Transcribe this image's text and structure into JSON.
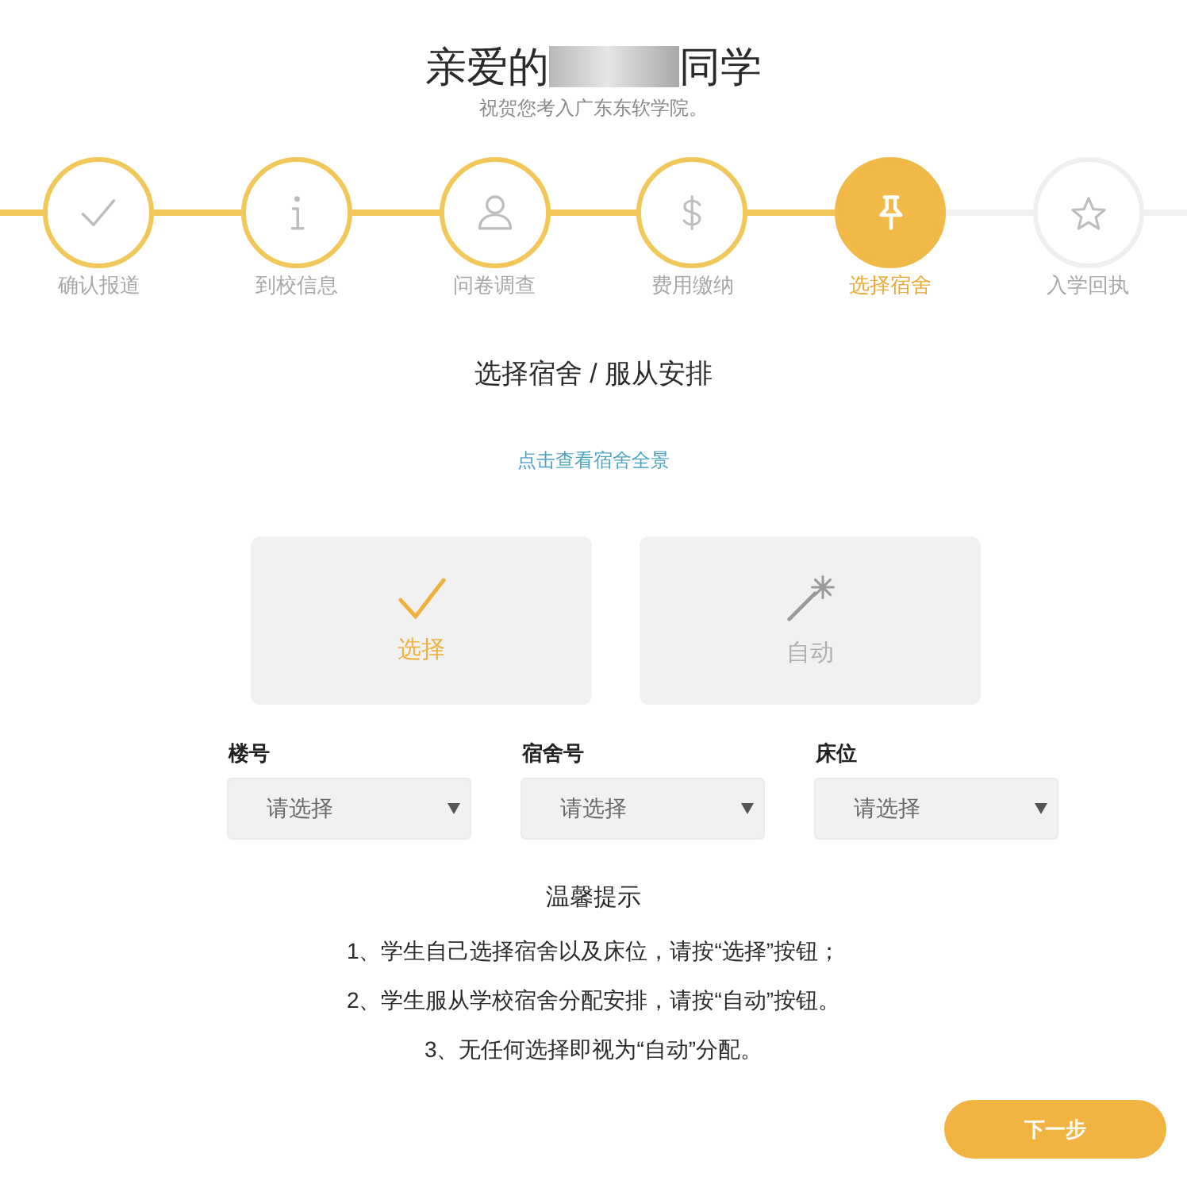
{
  "header": {
    "greeting_before": "亲爱的",
    "name_redacted": true,
    "greeting_after": "同学",
    "subtitle": "祝贺您考入广东东软学院。"
  },
  "steps": [
    {
      "label": "确认报道",
      "done": true,
      "selected": false
    },
    {
      "label": "到校信息",
      "done": true,
      "selected": false
    },
    {
      "label": "问卷调查",
      "done": true,
      "selected": false
    },
    {
      "label": "费用缴纳",
      "done": true,
      "selected": false
    },
    {
      "label": "选择宿舍",
      "done": false,
      "selected": true
    },
    {
      "label": "入学回执",
      "done": false,
      "selected": false
    }
  ],
  "section_title": "选择宿舍 / 服从安排",
  "panorama_link": "点击查看宿舍全景",
  "options": [
    {
      "label": "选择",
      "selected": true
    },
    {
      "label": "自动",
      "selected": false
    }
  ],
  "fields": [
    {
      "label": "楼号",
      "placeholder": "请选择"
    },
    {
      "label": "宿舍号",
      "placeholder": "请选择"
    },
    {
      "label": "床位",
      "placeholder": "请选择"
    }
  ],
  "tips": {
    "title": "温馨提示",
    "items": [
      "1、学生自己选择宿舍以及床位，请按“选择”按钮；",
      "2、学生服从学校宿舍分配安排，请按“自动”按钮。",
      "3、无任何选择即视为“自动”分配。"
    ]
  },
  "next_button": "下一步"
}
